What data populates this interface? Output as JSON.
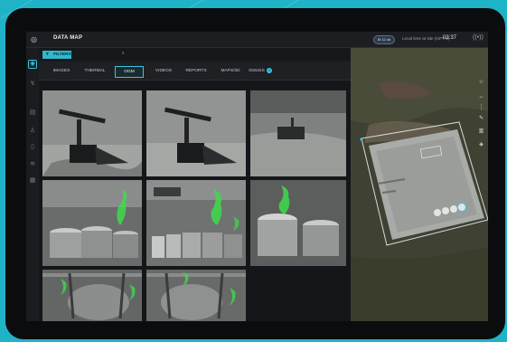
{
  "app": {
    "logo_icon": "drone-logo-icon",
    "title": "DATA MAP"
  },
  "topbar": {
    "status_pill": "M 12 ok",
    "local_time": "Local time at site (GPT-5)",
    "clock": "03:37",
    "signal_icon": "signal-icon"
  },
  "sidebar": {
    "items": [
      {
        "icon": "map-icon",
        "active": true
      },
      {
        "icon": "layers-icon",
        "active": false
      },
      {
        "icon": "chart-icon",
        "active": false
      },
      {
        "icon": "user-icon",
        "active": false
      },
      {
        "icon": "document-icon",
        "active": false
      },
      {
        "icon": "settings-icon",
        "active": false
      },
      {
        "icon": "calendar-icon",
        "active": false
      }
    ]
  },
  "filters": {
    "label": "FILTERS",
    "close": "x"
  },
  "tabs": [
    {
      "label": "IMAGES"
    },
    {
      "label": "THERMAL"
    },
    {
      "label": "OGM",
      "active": true
    },
    {
      "label": "VIDEOS"
    },
    {
      "label": "REPORTS"
    },
    {
      "label": "MAPS/3D"
    },
    {
      "label": "ISSUES",
      "badge": "4"
    }
  ],
  "map_tools": [
    "star-icon",
    "ruler-icon",
    "info-icon",
    "pencil-icon",
    "trash-icon",
    "layers-icon"
  ],
  "colors": {
    "accent": "#36c6dc",
    "frame_bg": "#1fb3c8",
    "device": "#0b0c0e",
    "gas_plume": "#3ddc4a"
  }
}
